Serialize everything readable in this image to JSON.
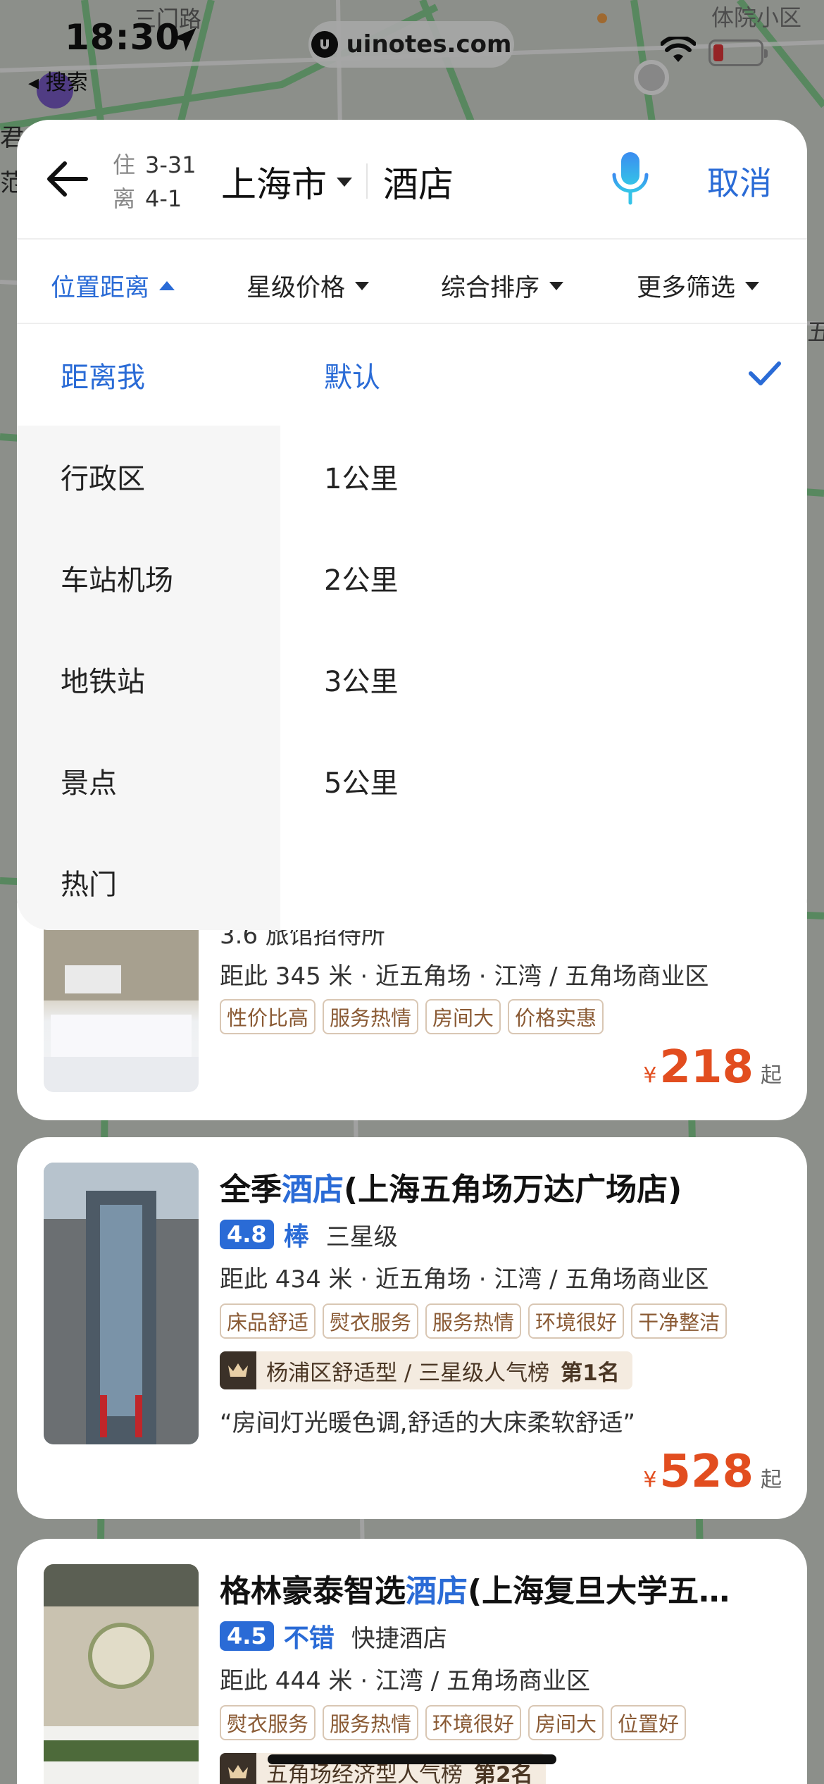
{
  "status_bar": {
    "time": "18:30",
    "back_app_label": "◂ 搜索",
    "url": "uinotes.com"
  },
  "map_labels": {
    "top_left": "三门路",
    "top_right": "体院小区",
    "left_1": "君",
    "left_2": "范",
    "right_edge": "五"
  },
  "search": {
    "checkin_label": "住",
    "checkin_date": "3-31",
    "checkout_label": "离",
    "checkout_date": "4-1",
    "city": "上海市",
    "query": "酒店",
    "cancel_label": "取消"
  },
  "filters": [
    {
      "label": "位置距离",
      "active": true
    },
    {
      "label": "星级价格",
      "active": false
    },
    {
      "label": "综合排序",
      "active": false
    },
    {
      "label": "更多筛选",
      "active": false
    }
  ],
  "location_categories": [
    {
      "label": "距离我",
      "active": true
    },
    {
      "label": "行政区",
      "active": false
    },
    {
      "label": "车站机场",
      "active": false
    },
    {
      "label": "地铁站",
      "active": false
    },
    {
      "label": "景点",
      "active": false
    },
    {
      "label": "热门",
      "active": false
    }
  ],
  "distance_options": [
    {
      "label": "默认",
      "selected": true
    },
    {
      "label": "1公里",
      "selected": false
    },
    {
      "label": "2公里",
      "selected": false
    },
    {
      "label": "3公里",
      "selected": false
    },
    {
      "label": "5公里",
      "selected": false
    }
  ],
  "hotels": [
    {
      "partial_text": "3.6  旅馆招待所",
      "distance": "距此 345 米 · 近五角场 · 江湾 / 五角场商业区",
      "tags": [
        "性价比高",
        "服务热情",
        "房间大",
        "价格实惠"
      ],
      "price_currency": "¥",
      "price": "218",
      "price_suffix": "起"
    },
    {
      "name_prefix": "全季",
      "name_keyword": "酒店",
      "name_suffix": "(上海五角场万达广场店)",
      "score": "4.8",
      "score_word": "棒",
      "level": "三星级",
      "distance": "距此 434 米 · 近五角场 · 江湾 / 五角场商业区",
      "tags": [
        "床品舒适",
        "熨衣服务",
        "服务热情",
        "环境很好",
        "干净整洁"
      ],
      "rank_text": "杨浦区舒适型 / 三星级人气榜",
      "rank_num": "第1名",
      "quote": "“房间灯光暖色调,舒适的大床柔软舒适”",
      "price_currency": "¥",
      "price": "528",
      "price_suffix": "起"
    },
    {
      "name_prefix": "格林豪泰智选",
      "name_keyword": "酒店",
      "name_suffix": "(上海复旦大学五…",
      "score": "4.5",
      "score_word": "不错",
      "level": "快捷酒店",
      "distance": "距此 444 米 · 江湾 / 五角场商业区",
      "tags": [
        "熨衣服务",
        "服务热情",
        "环境很好",
        "房间大",
        "位置好"
      ],
      "rank_text": "五角场经济型人气榜",
      "rank_num": "第2名"
    }
  ],
  "colors": {
    "accent": "#2a6bd6",
    "price": "#e24d1f",
    "map_road": "#7fcf8c"
  }
}
